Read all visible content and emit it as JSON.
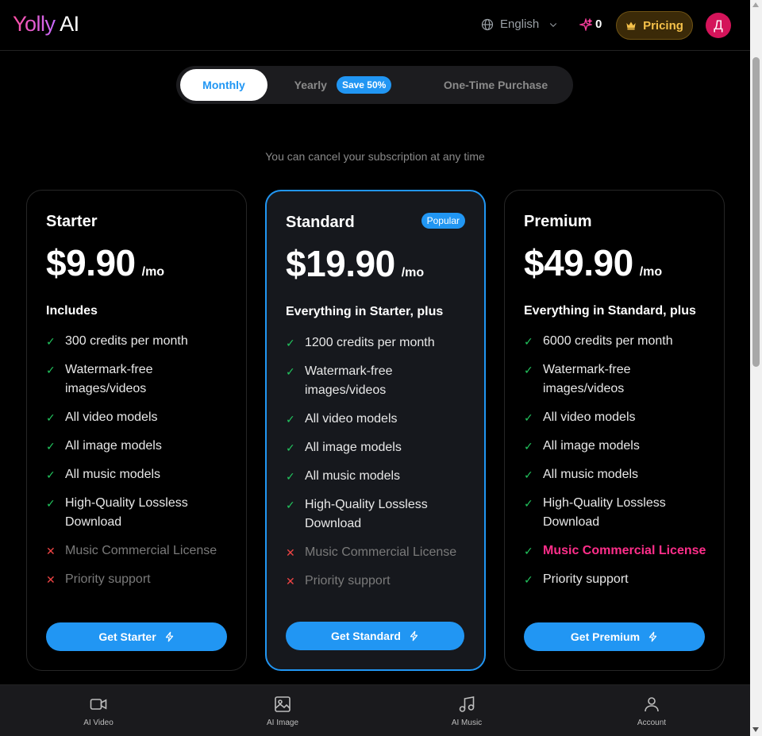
{
  "header": {
    "logo_brand": "Yolly",
    "logo_suffix": "AI",
    "language": "English",
    "credits": "0",
    "pricing_label": "Pricing",
    "avatar_initial": "Д"
  },
  "tabs": {
    "monthly": "Monthly",
    "yearly": "Yearly",
    "save_badge": "Save 50%",
    "one_time": "One-Time Purchase"
  },
  "cancel_note": "You can cancel your subscription at any time",
  "plans": [
    {
      "name": "Starter",
      "price": "$9.90",
      "period": "/mo",
      "includes": "Includes",
      "features": [
        {
          "text": "300 credits per month",
          "included": true
        },
        {
          "text": "Watermark-free images/videos",
          "included": true
        },
        {
          "text": "All video models",
          "included": true
        },
        {
          "text": "All image models",
          "included": true
        },
        {
          "text": "All music models",
          "included": true
        },
        {
          "text": "High-Quality Lossless Download",
          "included": true
        },
        {
          "text": "Music Commercial License",
          "included": false
        },
        {
          "text": "Priority support",
          "included": false
        }
      ],
      "cta": "Get Starter"
    },
    {
      "name": "Standard",
      "badge": "Popular",
      "price": "$19.90",
      "period": "/mo",
      "includes": "Everything in Starter, plus",
      "features": [
        {
          "text": "1200 credits per month",
          "included": true
        },
        {
          "text": "Watermark-free images/videos",
          "included": true
        },
        {
          "text": "All video models",
          "included": true
        },
        {
          "text": "All image models",
          "included": true
        },
        {
          "text": "All music models",
          "included": true
        },
        {
          "text": "High-Quality Lossless Download",
          "included": true
        },
        {
          "text": "Music Commercial License",
          "included": false
        },
        {
          "text": "Priority support",
          "included": false
        }
      ],
      "cta": "Get Standard"
    },
    {
      "name": "Premium",
      "price": "$49.90",
      "period": "/mo",
      "includes": "Everything in Standard, plus",
      "features": [
        {
          "text": "6000 credits per month",
          "included": true
        },
        {
          "text": "Watermark-free images/videos",
          "included": true
        },
        {
          "text": "All video models",
          "included": true
        },
        {
          "text": "All image models",
          "included": true
        },
        {
          "text": "All music models",
          "included": true
        },
        {
          "text": "High-Quality Lossless Download",
          "included": true
        },
        {
          "text": "Music Commercial License",
          "included": true
        },
        {
          "text": "Priority support",
          "included": true
        }
      ],
      "cta": "Get Premium"
    }
  ],
  "bottom_nav": {
    "video": "AI Video",
    "image": "AI Image",
    "music": "AI Music",
    "account": "Account"
  },
  "colors": {
    "accent": "#2196f3",
    "check": "#22c55e",
    "cross": "#ef4444",
    "highlight_text": "#ff2e8a",
    "pricing_gold": "#f5c14a",
    "avatar": "#d4145a"
  },
  "icons": {
    "language": "globe-icon",
    "credits": "sparkle-icon",
    "pricing": "crown-icon",
    "cta": "lightning-icon",
    "video": "video-camera-icon",
    "image": "image-icon",
    "music": "music-note-icon",
    "account": "user-icon"
  }
}
